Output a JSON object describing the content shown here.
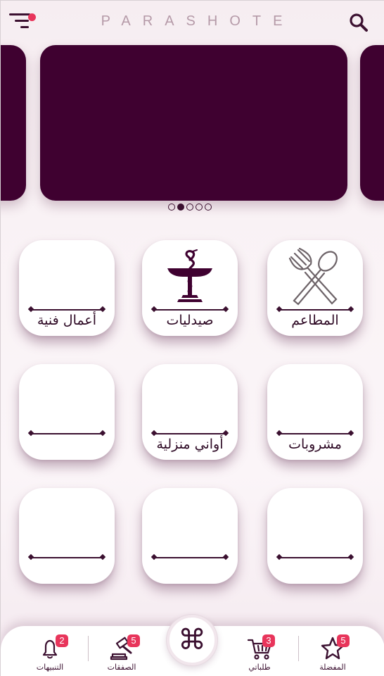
{
  "header": {
    "title": "PARASHOTE",
    "menu_icon": "menu-icon",
    "search_icon": "search-icon"
  },
  "carousel": {
    "slide_count": 5,
    "active_index": 1
  },
  "categories": [
    {
      "label": "المطاعم",
      "icon": "fork-spoon-icon"
    },
    {
      "label": "صيدليات",
      "icon": "pharmacy-icon"
    },
    {
      "label": "أعمال فنية",
      "icon": ""
    },
    {
      "label": "مشروبات",
      "icon": ""
    },
    {
      "label": "أواني منزلية",
      "icon": ""
    },
    {
      "label": "",
      "icon": ""
    },
    {
      "label": "",
      "icon": ""
    },
    {
      "label": "",
      "icon": ""
    },
    {
      "label": "",
      "icon": ""
    }
  ],
  "bottom_nav": {
    "favorites": {
      "label": "المفضلة",
      "badge": "5",
      "icon": "star-icon"
    },
    "orders": {
      "label": "طلباتي",
      "badge": "3",
      "icon": "cart-icon"
    },
    "center": {
      "glyph": "⌘",
      "icon": "command-icon"
    },
    "deals": {
      "label": "الصفقات",
      "badge": "5",
      "icon": "gavel-icon"
    },
    "notifications": {
      "label": "التنبيهات",
      "badge": "2",
      "icon": "bell-icon"
    }
  },
  "colors": {
    "primary": "#3f0130",
    "accent": "#e8355b",
    "title": "#b59aa8"
  }
}
